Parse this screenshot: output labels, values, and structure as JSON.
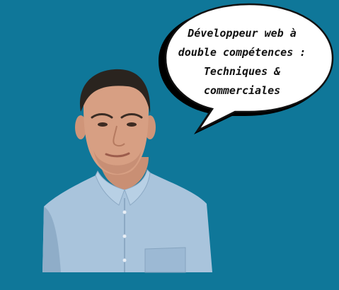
{
  "speech_bubble": {
    "lines": [
      "Développeur web à",
      "double compétences :",
      "Techniques &",
      "commerciales"
    ]
  },
  "colors": {
    "background": "#0f7799",
    "shirt": "#a9c4dc",
    "skin": "#d79f83",
    "hair": "#2a241f",
    "bubble_fill": "#ffffff",
    "bubble_outline": "#111111"
  },
  "icons": {
    "person": "portrait-photo"
  }
}
